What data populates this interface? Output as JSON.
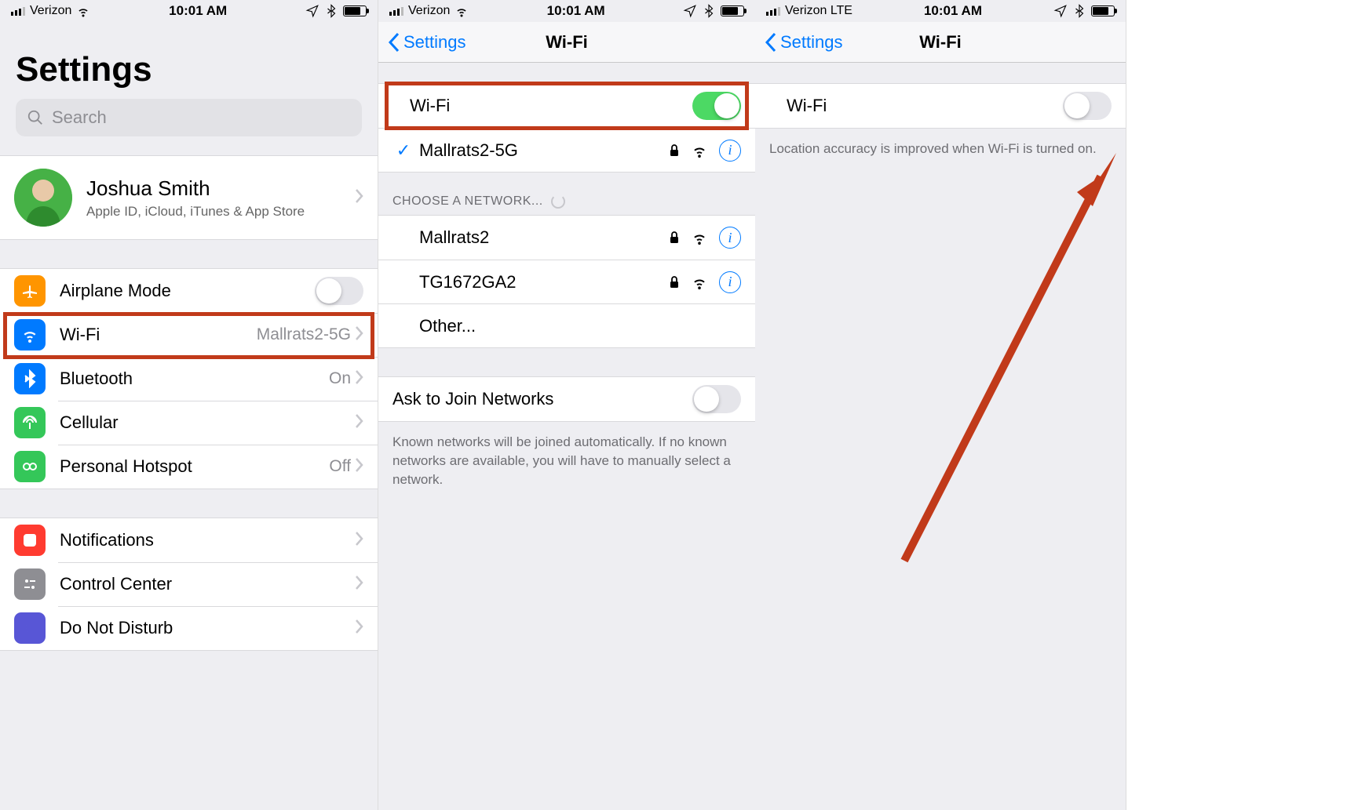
{
  "panel1": {
    "status": {
      "carrier": "Verizon",
      "net": "wifi",
      "time": "10:01 AM"
    },
    "title": "Settings",
    "search_placeholder": "Search",
    "profile": {
      "name": "Joshua Smith",
      "sub": "Apple ID, iCloud, iTunes & App Store"
    },
    "rows": {
      "airplane": {
        "label": "Airplane Mode"
      },
      "wifi": {
        "label": "Wi-Fi",
        "value": "Mallrats2-5G"
      },
      "bt": {
        "label": "Bluetooth",
        "value": "On"
      },
      "cell": {
        "label": "Cellular"
      },
      "hotspot": {
        "label": "Personal Hotspot",
        "value": "Off"
      },
      "notif": {
        "label": "Notifications"
      },
      "cc": {
        "label": "Control Center"
      },
      "dnd": {
        "label": "Do Not Disturb"
      }
    }
  },
  "panel2": {
    "status": {
      "carrier": "Verizon",
      "net": "wifi",
      "time": "10:01 AM"
    },
    "nav": {
      "back": "Settings",
      "title": "Wi-Fi"
    },
    "wifi_label": "Wi-Fi",
    "wifi_on": true,
    "connected": {
      "ssid": "Mallrats2-5G",
      "locked": true
    },
    "choose_header": "CHOOSE A NETWORK...",
    "networks": [
      {
        "ssid": "Mallrats2",
        "locked": true
      },
      {
        "ssid": "TG1672GA2",
        "locked": true
      },
      {
        "ssid": "Other...",
        "locked": false,
        "is_other": true
      }
    ],
    "ask_label": "Ask to Join Networks",
    "ask_on": false,
    "ask_footer": "Known networks will be joined automatically. If no known networks are available, you will have to manually select a network."
  },
  "panel3": {
    "status": {
      "carrier": "Verizon  LTE",
      "net": "lte",
      "time": "10:01 AM"
    },
    "nav": {
      "back": "Settings",
      "title": "Wi-Fi"
    },
    "wifi_label": "Wi-Fi",
    "wifi_on": false,
    "footer": "Location accuracy is improved when Wi-Fi is turned on."
  }
}
